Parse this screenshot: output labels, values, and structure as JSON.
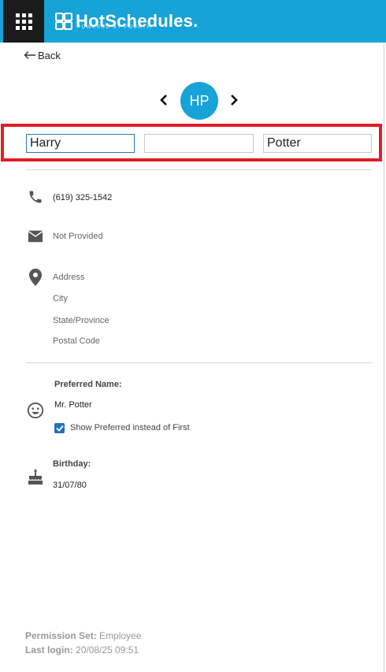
{
  "header": {
    "logo_text": "HotSchedules.",
    "logo_sub": "POWERED BY FOURTH",
    "brand_color": "#17a3d7"
  },
  "back": {
    "label": "Back"
  },
  "employee": {
    "initials": "HP",
    "first_name": "Harry",
    "middle_name": "",
    "last_name": "Potter"
  },
  "contact": {
    "phone": "(619) 325-1542",
    "email": "Not Provided",
    "address": "Address",
    "city": "City",
    "state": "State/Province",
    "postal": "Postal Code"
  },
  "preferred": {
    "label": "Preferred Name:",
    "value": "Mr. Potter",
    "show_label": "Show Preferred instead of First",
    "checked": true
  },
  "birthday": {
    "label": "Birthday:",
    "value": "31/07/80"
  },
  "footer": {
    "permission_label": "Permission Set:",
    "permission_value": "Employee",
    "login_label": "Last login:",
    "login_value": "20/08/25 09:51"
  },
  "icons": {
    "apps": "grid-icon",
    "phone": "phone-icon",
    "email": "envelope-icon",
    "address": "map-pin-icon",
    "preferred": "smiley-icon",
    "birthday": "cake-icon"
  }
}
